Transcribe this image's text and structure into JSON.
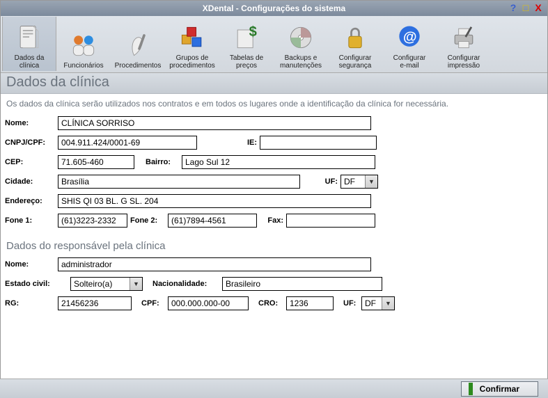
{
  "window": {
    "title": "XDental - Configurações do sistema"
  },
  "toolbar": {
    "items": [
      {
        "line1": "Dados da",
        "line2": "clínica"
      },
      {
        "line1": "Funcionários",
        "line2": ""
      },
      {
        "line1": "Procedimentos",
        "line2": ""
      },
      {
        "line1": "Grupos de",
        "line2": "procedimentos"
      },
      {
        "line1": "Tabelas de",
        "line2": "preços"
      },
      {
        "line1": "Backups e",
        "line2": "manutenções"
      },
      {
        "line1": "Configurar",
        "line2": "segurança"
      },
      {
        "line1": "Configurar",
        "line2": "e-mail"
      },
      {
        "line1": "Configurar",
        "line2": "impressão"
      }
    ]
  },
  "section": {
    "title": "Dados da clínica",
    "description": "Os dados da clínica serão utilizados nos contratos e em todos os lugares onde a identificação da clínica for necessária."
  },
  "labels": {
    "nome": "Nome:",
    "cnpj": "CNPJ/CPF:",
    "ie": "IE:",
    "cep": "CEP:",
    "bairro": "Bairro:",
    "cidade": "Cidade:",
    "uf": "UF:",
    "endereco": "Endereço:",
    "fone1": "Fone 1:",
    "fone2": "Fone 2:",
    "fax": "Fax:",
    "resp_heading": "Dados do responsável pela clínica",
    "resp_nome": "Nome:",
    "estado_civil": "Estado civil:",
    "nacionalidade": "Nacionalidade:",
    "rg": "RG:",
    "cpf": "CPF:",
    "cro": "CRO:",
    "uf2": "UF:"
  },
  "clinica": {
    "nome": "CLÍNICA SORRISO",
    "cnpj": "004.911.424/0001-69",
    "ie": "",
    "cep": "71.605-460",
    "bairro": "Lago Sul 12",
    "cidade": "Brasília",
    "uf": "DF",
    "endereco": "SHIS QI 03 BL. G SL. 204",
    "fone1": "(61)3223-2332",
    "fone2": "(61)7894-4561",
    "fax": ""
  },
  "responsavel": {
    "nome": "administrador",
    "estado_civil": "Solteiro(a)",
    "nacionalidade": "Brasileiro",
    "rg": "21456236",
    "cpf": "000.000.000-00",
    "cro": "1236",
    "uf": "DF"
  },
  "footer": {
    "confirm": "Confirmar"
  }
}
